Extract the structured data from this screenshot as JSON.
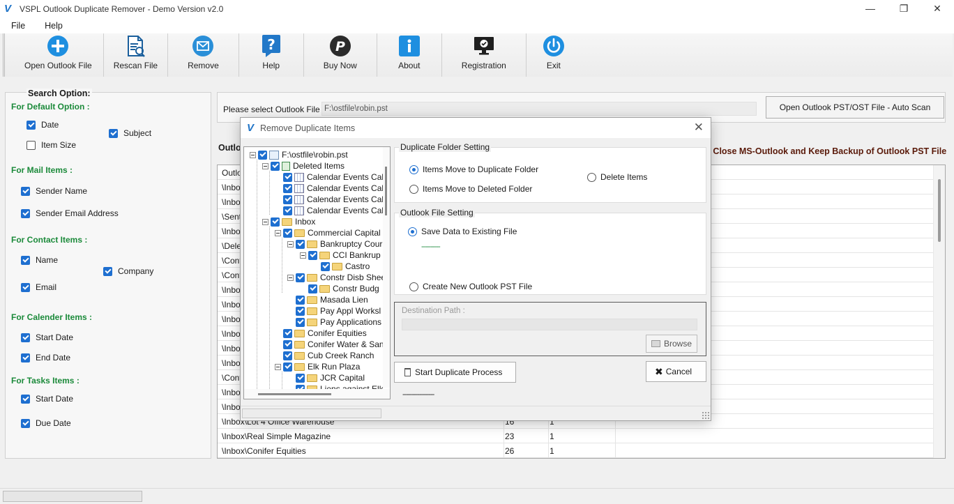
{
  "window": {
    "title": "VSPL Outlook Duplicate Remover - Demo Version v2.0",
    "icon_letter": "V",
    "controls": [
      "—",
      "❐",
      "✕"
    ]
  },
  "menu": [
    "File",
    "Help"
  ],
  "toolbar": [
    {
      "label": "Open Outlook File",
      "icon": "plus-circle-icon"
    },
    {
      "label": "Rescan File",
      "icon": "rescan-document-icon"
    },
    {
      "label": "Remove",
      "icon": "mail-icon"
    },
    {
      "label": "Help",
      "icon": "question-icon"
    },
    {
      "label": "Buy Now",
      "icon": "paypal-icon"
    },
    {
      "label": "About",
      "icon": "info-icon"
    },
    {
      "label": "Registration",
      "icon": "monitor-check-icon"
    },
    {
      "label": "Exit",
      "icon": "power-icon"
    }
  ],
  "search": {
    "title": "Search Option:",
    "default_section": "For Default Option :",
    "default_items": [
      {
        "label": "Date",
        "checked": true
      },
      {
        "label": "Subject",
        "checked": true
      },
      {
        "label": "Item Size",
        "checked": false
      }
    ],
    "mail_section": "For Mail Items :",
    "mail_items": [
      {
        "label": "Sender Name",
        "checked": true
      },
      {
        "label": "Sender Email Address",
        "checked": true
      }
    ],
    "contact_section": "For Contact Items :",
    "contact_items": [
      {
        "label": "Name",
        "checked": true
      },
      {
        "label": "Company",
        "checked": true
      },
      {
        "label": "Email",
        "checked": true
      }
    ],
    "calendar_section": "For Calender Items :",
    "calendar_items": [
      {
        "label": "Start Date",
        "checked": true
      },
      {
        "label": "End Date",
        "checked": true
      }
    ],
    "tasks_section": "For Tasks Items :",
    "tasks_items": [
      {
        "label": "Start Date",
        "checked": true
      },
      {
        "label": "Due Date",
        "checked": true
      }
    ]
  },
  "file_select": {
    "label": "Please select Outlook File :",
    "path": "F:\\ostfile\\robin.pst",
    "auto_scan_label": "Open Outlook PST/OST File - Auto Scan"
  },
  "outlook_label": "Outlo",
  "warning_text": "e Close MS-Outlook and Keep Backup of Outlook PST File",
  "grid_rows": [
    {
      "path": "Outlo",
      "count": "",
      "dup": ""
    },
    {
      "path": "\\Inbo",
      "count": "",
      "dup": ""
    },
    {
      "path": "\\Inbo",
      "count": "",
      "dup": ""
    },
    {
      "path": "\\Sent",
      "count": "",
      "dup": ""
    },
    {
      "path": "\\Inbo",
      "count": "",
      "dup": ""
    },
    {
      "path": "\\Dele",
      "count": "",
      "dup": ""
    },
    {
      "path": "\\Cont",
      "count": "",
      "dup": ""
    },
    {
      "path": "\\Cont",
      "count": "",
      "dup": ""
    },
    {
      "path": "\\Inbo",
      "count": "",
      "dup": ""
    },
    {
      "path": "\\Inbo",
      "count": "",
      "dup": ""
    },
    {
      "path": "\\Inbo",
      "count": "",
      "dup": ""
    },
    {
      "path": "\\Inbo",
      "count": "",
      "dup": ""
    },
    {
      "path": "\\Inbo",
      "count": "",
      "dup": ""
    },
    {
      "path": "\\Inbo",
      "count": "",
      "dup": ""
    },
    {
      "path": "\\Cont",
      "count": "",
      "dup": ""
    },
    {
      "path": "\\Inbo",
      "count": "",
      "dup": ""
    },
    {
      "path": "\\Inbo",
      "count": "",
      "dup": ""
    },
    {
      "path": "\\Inbox\\Lot 4 Office Warehouse",
      "count": "16",
      "dup": "1"
    },
    {
      "path": "\\Inbox\\Real Simple Magazine",
      "count": "23",
      "dup": "1"
    },
    {
      "path": "\\Inbox\\Conifer Equities",
      "count": "26",
      "dup": "1"
    }
  ],
  "dialog": {
    "title": "Remove Duplicate Items",
    "tree": [
      {
        "label": "F:\\ostfile\\robin.pst",
        "icon": "pst",
        "x": 0
      },
      {
        "label": "Deleted Items",
        "icon": "trash",
        "x": 1
      },
      {
        "label": "Calendar Events Cal",
        "icon": "cal",
        "x": 2
      },
      {
        "label": "Calendar Events Cal",
        "icon": "cal",
        "x": 2
      },
      {
        "label": "Calendar Events Cal",
        "icon": "cal",
        "x": 2
      },
      {
        "label": "Calendar Events Cal",
        "icon": "cal",
        "x": 2
      },
      {
        "label": "Inbox",
        "icon": "fold",
        "x": 1
      },
      {
        "label": "Commercial Capital",
        "icon": "fold",
        "x": 2
      },
      {
        "label": "Bankruptcy Cour",
        "icon": "fold",
        "x": 3
      },
      {
        "label": "CCI Bankrup",
        "icon": "fold",
        "x": 4
      },
      {
        "label": "Castro",
        "icon": "fold",
        "x": 5
      },
      {
        "label": "Constr Disb Shee",
        "icon": "fold",
        "x": 3
      },
      {
        "label": "Constr Budg",
        "icon": "fold",
        "x": 4
      },
      {
        "label": "Masada Lien",
        "icon": "fold",
        "x": 3
      },
      {
        "label": "Pay Appl Worksl",
        "icon": "fold",
        "x": 3
      },
      {
        "label": "Pay Applications",
        "icon": "fold",
        "x": 3
      },
      {
        "label": "Conifer Equities",
        "icon": "fold",
        "x": 2
      },
      {
        "label": "Conifer Water & San",
        "icon": "fold",
        "x": 2
      },
      {
        "label": "Cub Creek Ranch",
        "icon": "fold",
        "x": 2
      },
      {
        "label": "Elk Run Plaza",
        "icon": "fold",
        "x": 2
      },
      {
        "label": "JCR Capital",
        "icon": "fold",
        "x": 3
      },
      {
        "label": "Liens against Elk",
        "icon": "fold",
        "x": 3
      }
    ],
    "folder_setting": {
      "legend": "Duplicate Folder Setting",
      "options": [
        {
          "label": "Items Move to Duplicate Folder",
          "selected": true
        },
        {
          "label": "Items Move to Deleted Folder",
          "selected": false
        },
        {
          "label": "Delete Items",
          "selected": false
        }
      ]
    },
    "file_setting": {
      "legend": "Outlook File Setting",
      "save_existing": "Save Data to Existing File",
      "save_existing_status": "----------",
      "create_new": "Create New Outlook PST File"
    },
    "destination": {
      "label": "Destination Path :",
      "value": "",
      "browse_label": "Browse"
    },
    "start_label": "Start Duplicate Process",
    "cancel_label": "Cancel",
    "progress_text": "-----------------"
  },
  "colors": {
    "accent": "#1e6fd0",
    "section_green": "#1b8a3a",
    "warning_text": "#5a1a0a"
  }
}
